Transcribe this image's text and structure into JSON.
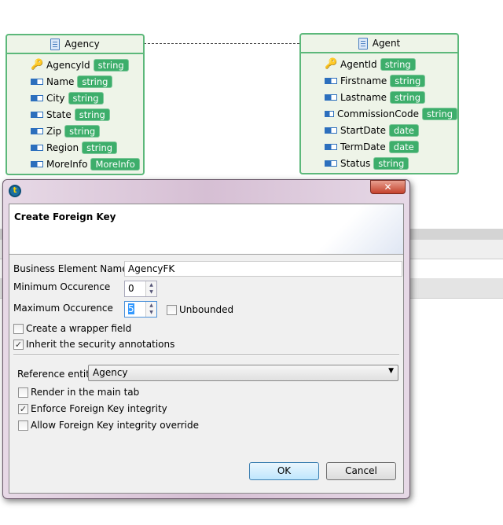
{
  "diagram": {
    "agency": {
      "title": "Agency",
      "fields": [
        {
          "name": "AgencyId",
          "type": "string",
          "key": true
        },
        {
          "name": "Name",
          "type": "string"
        },
        {
          "name": "City",
          "type": "string"
        },
        {
          "name": "State",
          "type": "string"
        },
        {
          "name": "Zip",
          "type": "string"
        },
        {
          "name": "Region",
          "type": "string"
        },
        {
          "name": "MoreInfo",
          "type": "MoreInfo"
        }
      ]
    },
    "agent": {
      "title": "Agent",
      "fields": [
        {
          "name": "AgentId",
          "type": "string",
          "key": true
        },
        {
          "name": "Firstname",
          "type": "string"
        },
        {
          "name": "Lastname",
          "type": "string"
        },
        {
          "name": "CommissionCode",
          "type": "string"
        },
        {
          "name": "StartDate",
          "type": "date"
        },
        {
          "name": "TermDate",
          "type": "date"
        },
        {
          "name": "Status",
          "type": "string"
        }
      ]
    }
  },
  "dialog": {
    "title": "Create Foreign Key",
    "business_element_name_label": "Business Element Name",
    "business_element_name_value": "AgencyFK",
    "min_label": "Minimum Occurence",
    "min_value": "0",
    "max_label": "Maximum Occurence",
    "max_value": "5",
    "unbounded_label": "Unbounded",
    "unbounded_checked": false,
    "wrapper_label": "Create a wrapper field",
    "wrapper_checked": false,
    "inherit_label": "Inherit the security annotations",
    "inherit_checked": true,
    "reference_entity_label": "Reference entity",
    "reference_entity_value": "Agency",
    "render_label": "Render in the main tab",
    "render_checked": false,
    "enforce_label": "Enforce Foreign Key integrity",
    "enforce_checked": true,
    "allow_label": "Allow Foreign Key integrity override",
    "allow_checked": false,
    "ok_label": "OK",
    "cancel_label": "Cancel",
    "close_glyph": "✕",
    "check_glyph": "✓",
    "app_icon_glyph": "t"
  }
}
